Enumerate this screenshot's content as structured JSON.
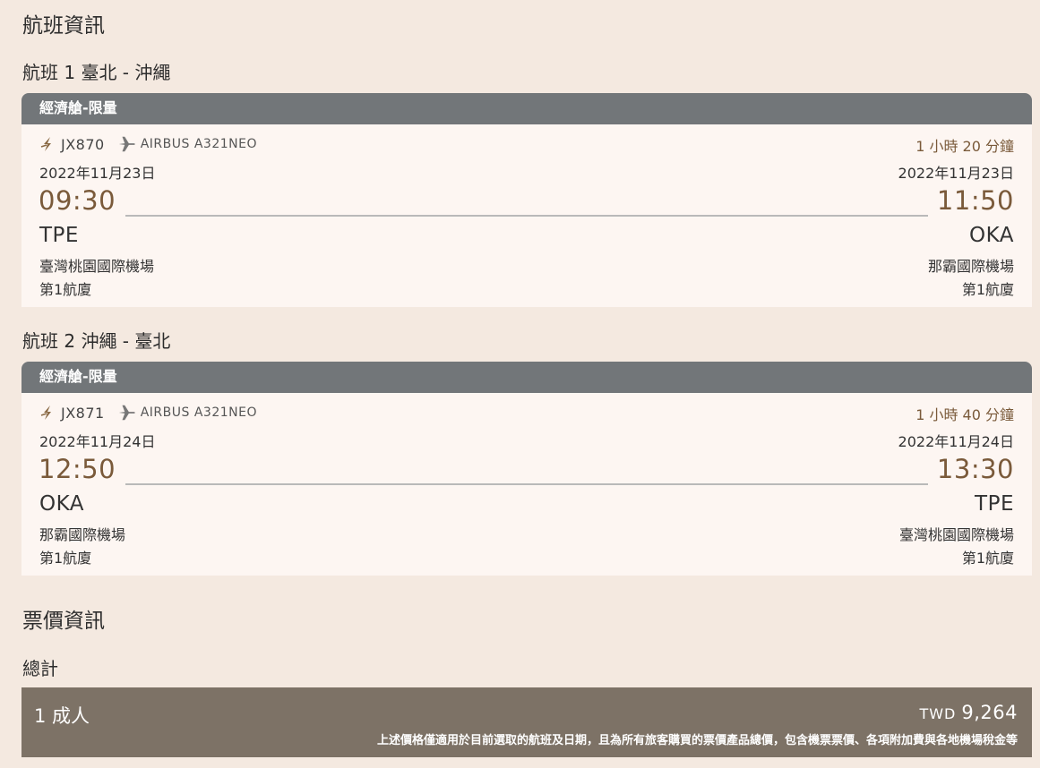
{
  "flight_info": {
    "title": "航班資訊",
    "legs": [
      {
        "title": "航班 1 臺北 - 沖繩",
        "cabin": "經濟艙-限量",
        "flight_number": "JX870",
        "aircraft": "AIRBUS A321NEO",
        "duration": "1 小時 20 分鐘",
        "depart": {
          "date": "2022年11月23日",
          "time": "09:30",
          "code": "TPE",
          "airport": "臺灣桃園國際機場",
          "terminal": "第1航廈"
        },
        "arrive": {
          "date": "2022年11月23日",
          "time": "11:50",
          "code": "OKA",
          "airport": "那霸國際機場",
          "terminal": "第1航廈"
        }
      },
      {
        "title": "航班 2 沖繩 - 臺北",
        "cabin": "經濟艙-限量",
        "flight_number": "JX871",
        "aircraft": "AIRBUS A321NEO",
        "duration": "1 小時 40 分鐘",
        "depart": {
          "date": "2022年11月24日",
          "time": "12:50",
          "code": "OKA",
          "airport": "那霸國際機場",
          "terminal": "第1航廈"
        },
        "arrive": {
          "date": "2022年11月24日",
          "time": "13:30",
          "code": "TPE",
          "airport": "臺灣桃園國際機場",
          "terminal": "第1航廈"
        }
      }
    ]
  },
  "fare_info": {
    "title": "票價資訊",
    "total_label": "總計",
    "passengers": "1 成人",
    "currency": "TWD",
    "amount": "9,264",
    "note": "上述價格僅適用於目前選取的航班及日期，且為所有旅客購買的票價產品總價，包含機票票價、各項附加費與各地機場稅金等"
  },
  "colors": {
    "background": "#f4e9e0",
    "card_header": "#727679",
    "card_body": "#fdf6f2",
    "accent_brown": "#7a5a3a",
    "total_box": "#7d7266"
  },
  "icons": {
    "airline": "starlux-bolt-icon",
    "aircraft": "airplane-icon"
  }
}
